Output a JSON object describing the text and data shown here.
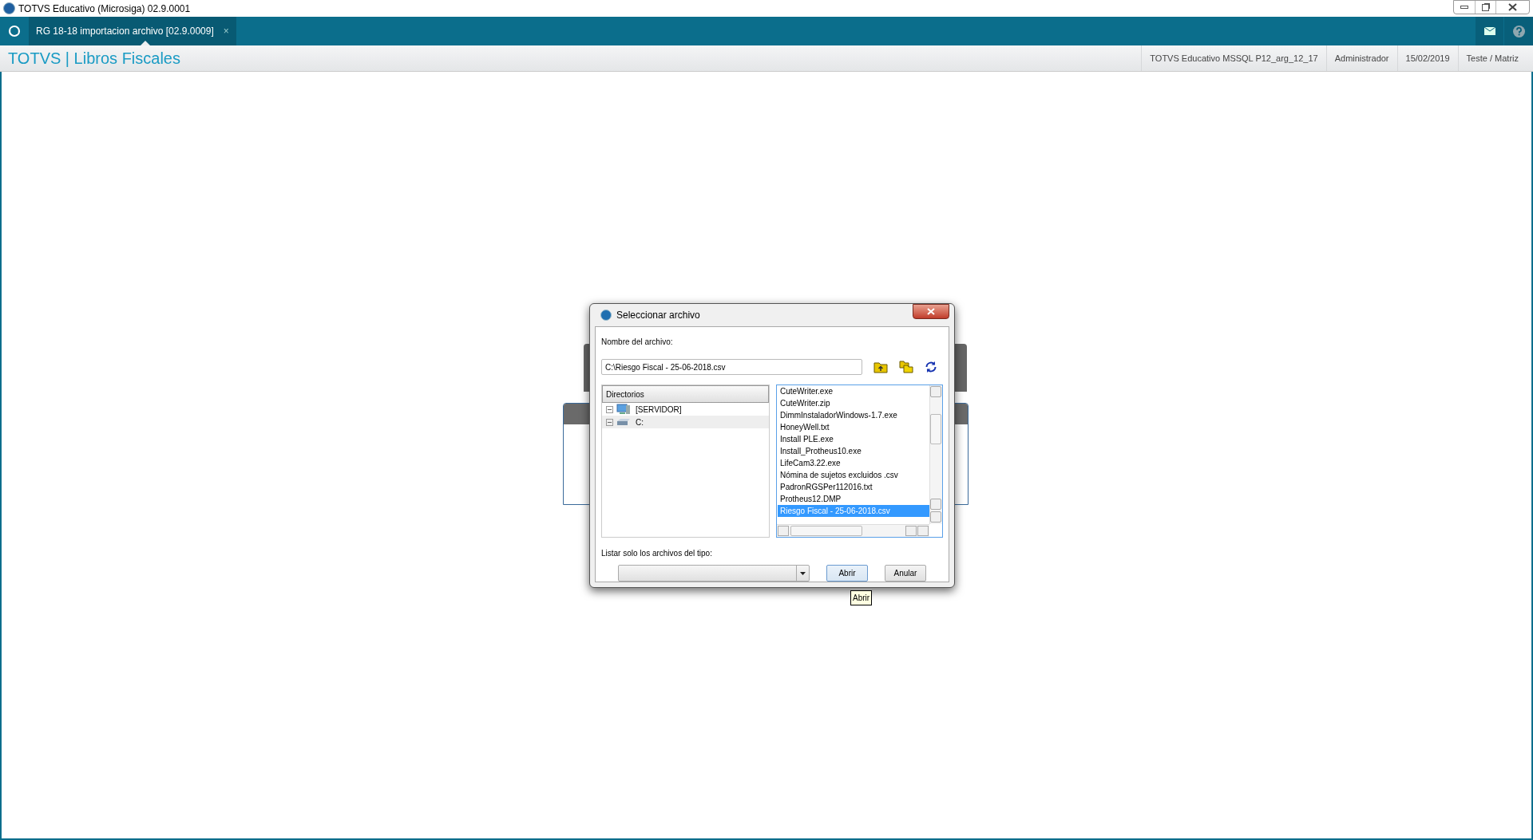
{
  "window": {
    "title": "TOTVS Educativo (Microsiga) 02.9.0001"
  },
  "tabs": [
    {
      "label": "RG 18-18 importacion archivo [02.9.0009]",
      "selected": true,
      "close": "×"
    }
  ],
  "header": {
    "title": "TOTVS | Libros Fiscales",
    "info": [
      "TOTVS Educativo MSSQL P12_arg_12_17",
      "Administrador",
      "15/02/2019",
      "Teste / Matriz"
    ]
  },
  "dialog": {
    "title": "Seleccionar archivo",
    "file_label": "Nombre del archivo:",
    "file_value": "C:\\Riesgo Fiscal - 25-06-2018.csv",
    "tree_header": "Directorios",
    "tree": [
      {
        "label": "[SERVIDOR]",
        "kind": "server",
        "selected": false
      },
      {
        "label": "C:",
        "kind": "drive",
        "selected": true
      }
    ],
    "files": [
      {
        "name": "CuteWriter.exe",
        "selected": false
      },
      {
        "name": "CuteWriter.zip",
        "selected": false
      },
      {
        "name": "DimmInstaladorWindows-1.7.exe",
        "selected": false
      },
      {
        "name": "HoneyWell.txt",
        "selected": false
      },
      {
        "name": "Install PLE.exe",
        "selected": false
      },
      {
        "name": "Install_Protheus10.exe",
        "selected": false
      },
      {
        "name": "LifeCam3.22.exe",
        "selected": false
      },
      {
        "name": "Nómina de sujetos excluidos .csv",
        "selected": false
      },
      {
        "name": "PadronRGSPer112016.txt",
        "selected": false
      },
      {
        "name": "Protheus12.DMP",
        "selected": false
      },
      {
        "name": "Riesgo Fiscal - 25-06-2018.csv",
        "selected": true
      }
    ],
    "type_label": "Listar solo los archivos del tipo:",
    "buttons": [
      "Abrir",
      "Anular"
    ],
    "tooltip": "Abrir"
  }
}
